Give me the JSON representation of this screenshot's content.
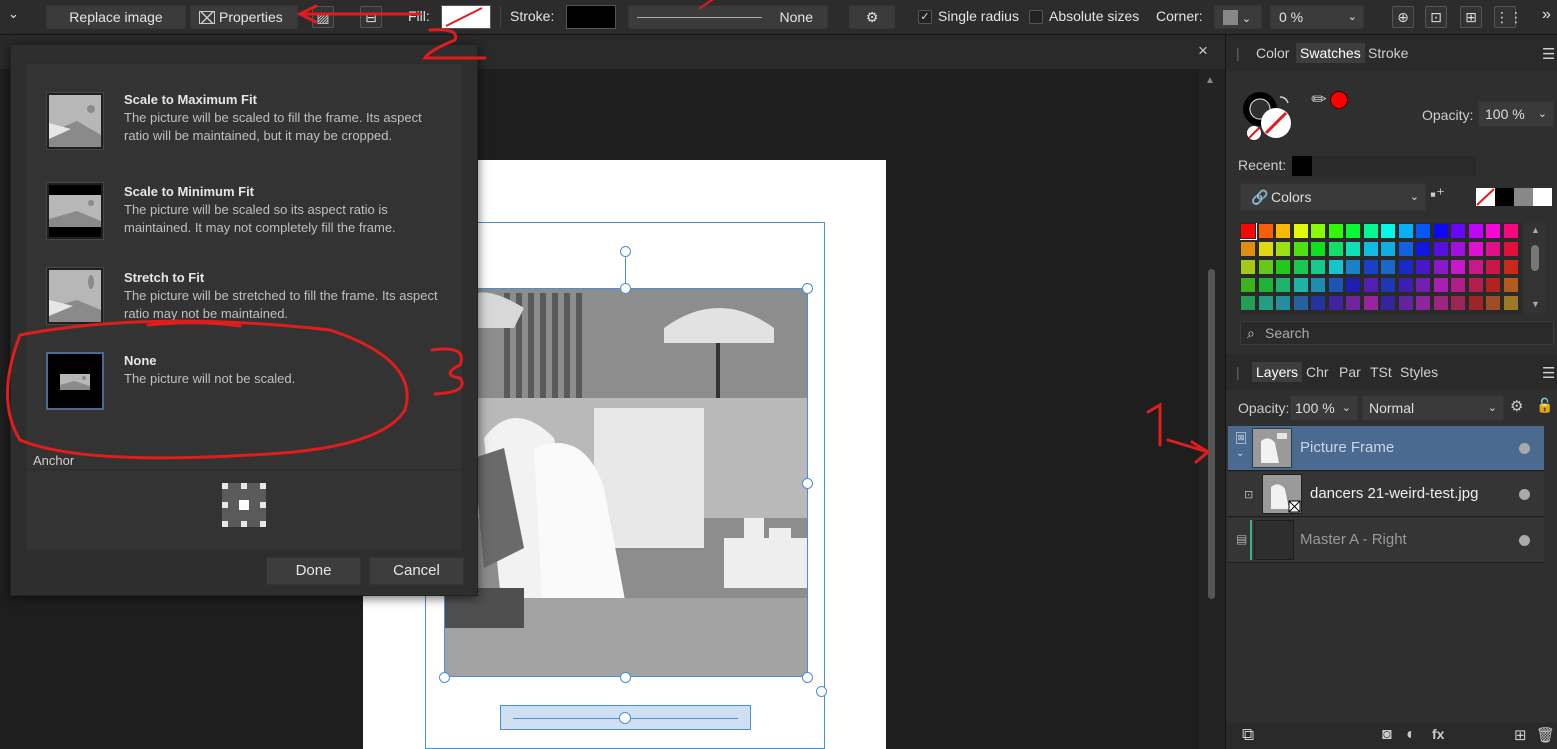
{
  "toolbar": {
    "replace_image": "Replace image",
    "properties": "Properties",
    "fill_label": "Fill:",
    "stroke_label": "Stroke:",
    "stroke_style_value": "None",
    "single_radius": "Single radius",
    "absolute_sizes": "Absolute sizes",
    "corner_label": "Corner:",
    "corner_value": "0 %",
    "overflow": "»"
  },
  "document": {
    "close": "×"
  },
  "popup": {
    "options": [
      {
        "title": "Scale to Maximum Fit",
        "desc": "The picture will be scaled to fill the frame. Its aspect ratio will be maintained, but it may be cropped."
      },
      {
        "title": "Scale to Minimum Fit",
        "desc": "The picture will be scaled so its aspect ratio is maintained. It may not completely fill the frame."
      },
      {
        "title": "Stretch to Fit",
        "desc": "The picture will be stretched to fill the frame. Its aspect ratio may not be maintained."
      },
      {
        "title": "None",
        "desc": "The picture will not be scaled."
      }
    ],
    "anchor_label": "Anchor",
    "done": "Done",
    "cancel": "Cancel"
  },
  "color_panel": {
    "tabs": [
      "Color",
      "Swatches",
      "Stroke"
    ],
    "active_tab": "Swatches",
    "opacity_label": "Opacity:",
    "opacity_value": "100 %",
    "recent_label": "Recent:",
    "palette_name": "Colors",
    "search_placeholder": "Search"
  },
  "layers_panel": {
    "tabs": [
      "Layers",
      "Chr",
      "Par",
      "TSt",
      "Styles"
    ],
    "active_tab": "Layers",
    "opacity_label": "Opacity:",
    "opacity_value": "100 %",
    "blend_mode": "Normal",
    "layers": [
      {
        "name": "Picture Frame",
        "selected": true
      },
      {
        "name": "dancers 21-weird-test.jpg",
        "selected": false
      },
      {
        "name": "Master A - Right",
        "selected": false
      }
    ]
  },
  "annotations": [
    "1",
    "2",
    "3"
  ],
  "colors": {
    "selection": "#4a6a90",
    "annotation": "#e01c1c",
    "frame_outline": "#4a90d9"
  }
}
